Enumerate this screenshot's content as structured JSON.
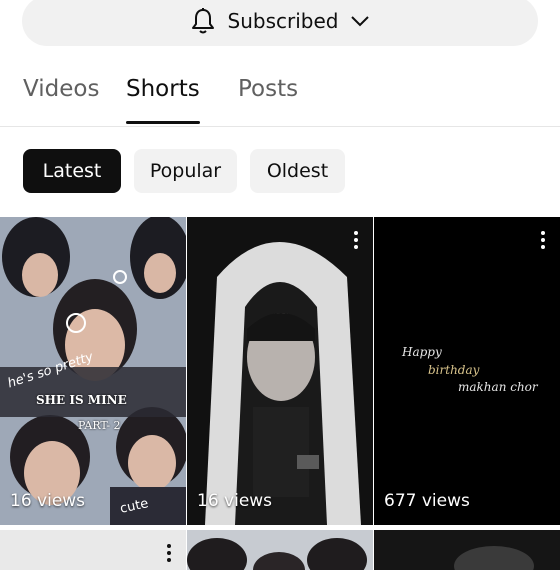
{
  "subscribe": {
    "label": "Subscribed"
  },
  "tabs": [
    {
      "label": "Videos",
      "active": false
    },
    {
      "label": "Shorts",
      "active": true
    },
    {
      "label": "Posts",
      "active": false
    }
  ],
  "chips": [
    {
      "label": "Latest",
      "active": true
    },
    {
      "label": "Popular",
      "active": false
    },
    {
      "label": "Oldest",
      "active": false
    }
  ],
  "shorts": [
    {
      "views": "16 views",
      "overlay": [
        "he's so pretty",
        "SHE IS MINE",
        "PART- 2",
        "cute"
      ]
    },
    {
      "views": "16 views"
    },
    {
      "views": "677 views",
      "overlay": [
        "Happy",
        "birthday",
        "makhan chor"
      ]
    }
  ],
  "icons": {
    "bell": "bell-icon",
    "chevron": "chevron-down-icon",
    "more": "more-vert-icon"
  }
}
